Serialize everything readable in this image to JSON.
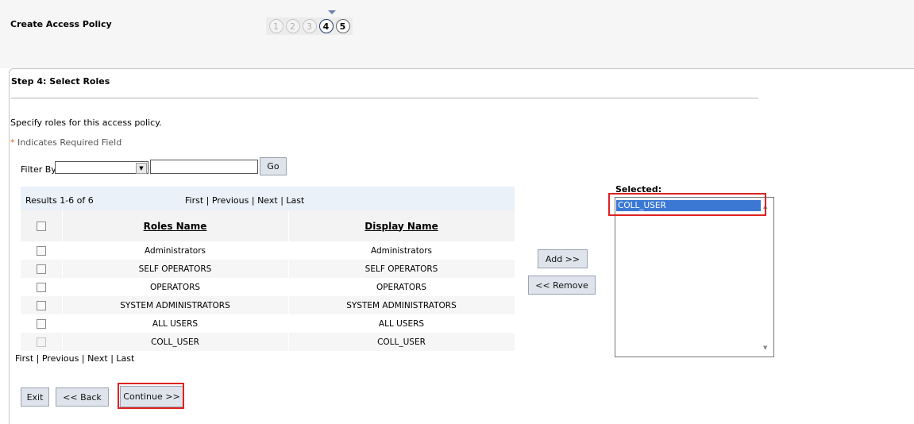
{
  "header": {
    "title": "Create Access Policy",
    "steps": [
      "1",
      "2",
      "3",
      "4",
      "5"
    ],
    "current_step": 4
  },
  "step": {
    "title": "Step 4: Select Roles",
    "description": "Specify roles for this access policy.",
    "required_star": "*",
    "required_note": "Indicates Required Field"
  },
  "filter": {
    "label": "Filter By",
    "selected": "",
    "value": "",
    "go_label": "Go"
  },
  "results": {
    "count": "Results 1-6 of 6",
    "nav": {
      "first": "First",
      "previous": "Previous",
      "next": "Next",
      "last": "Last"
    }
  },
  "table": {
    "headers": [
      "Roles Name",
      "Display Name"
    ],
    "rows": [
      {
        "role": "Administrators",
        "display": "Administrators"
      },
      {
        "role": "SELF OPERATORS",
        "display": "SELF OPERATORS"
      },
      {
        "role": "OPERATORS",
        "display": "OPERATORS"
      },
      {
        "role": "SYSTEM ADMINISTRATORS",
        "display": "SYSTEM ADMINISTRATORS"
      },
      {
        "role": "ALL USERS",
        "display": "ALL USERS"
      },
      {
        "role": "COLL_USER",
        "display": "COLL_USER"
      }
    ]
  },
  "actions": {
    "add_label": "Add >>",
    "remove_label": "<< Remove"
  },
  "selected": {
    "label": "Selected:",
    "items": [
      "COLL_USER"
    ]
  },
  "footer": {
    "exit_label": "Exit",
    "back_label": "<< Back",
    "continue_label": "Continue >>"
  },
  "colors": {
    "highlight": "#dd2222",
    "selection": "#3a78d4",
    "results_bar": "#eaf1f9"
  }
}
